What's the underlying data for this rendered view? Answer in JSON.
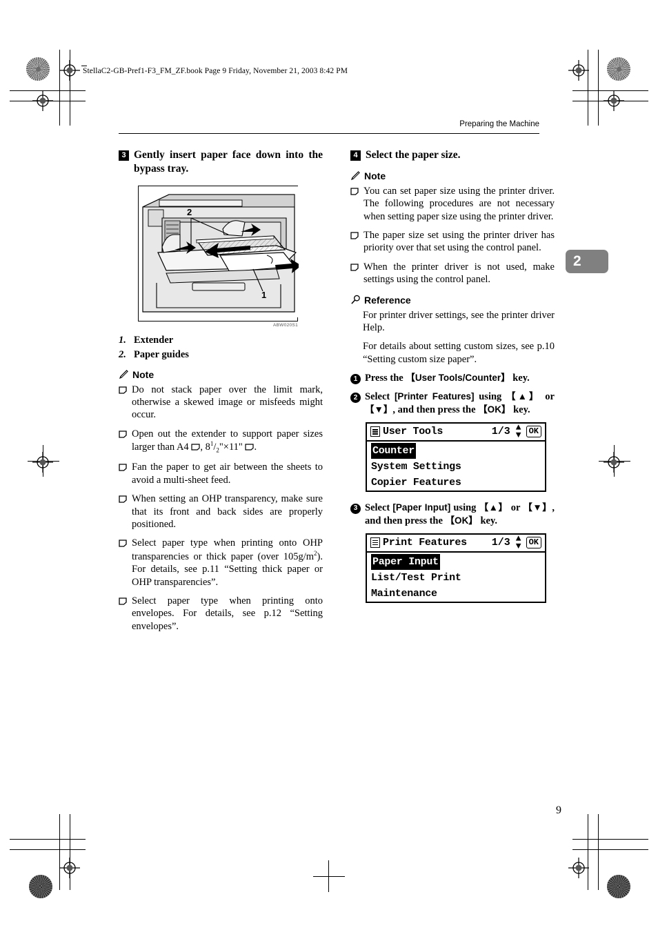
{
  "file_header": "StellaC2-GB-Pref1-F3_FM_ZF.book  Page 9  Friday, November 21, 2003  8:42 PM",
  "running_header": "Preparing the Machine",
  "chapter_tab": "2",
  "page_number": "9",
  "left_column": {
    "step": {
      "number": "3",
      "text": "Gently insert paper face down into the bypass tray."
    },
    "figure": {
      "code": "ABW020S1",
      "callout_1": "1",
      "callout_2": "2"
    },
    "callouts": [
      {
        "num": "1.",
        "label": "Extender"
      },
      {
        "num": "2.",
        "label": "Paper guides"
      }
    ],
    "note_heading": "Note",
    "notes": [
      "Do not stack paper over the limit mark, otherwise a skewed image or misfeeds might occur.",
      "Open out the extender to support paper sizes larger than A4",
      "Fan the paper to get air between the sheets to avoid a multi-sheet feed.",
      "When setting an OHP transparency, make sure that its front and back sides are properly positioned.",
      "Select paper type when printing onto OHP transparencies or thick paper (over 105g/m",
      "Select paper type when printing onto envelopes. For details, see p.12 “Setting envelopes”."
    ],
    "note2_tail": ", 8",
    "note2_frac_num": "1",
    "note2_frac_den": "2",
    "note2_tail2": "\"×11\" ",
    "note2_end": ".",
    "note5_sup": "2",
    "note5_tail": "). For details, see p.11 “Setting thick paper or OHP transparencies”."
  },
  "right_column": {
    "step": {
      "number": "4",
      "text": "Select the paper size."
    },
    "note_heading": "Note",
    "notes": [
      "You can set paper size using the printer driver. The following procedures are not necessary when setting paper size using the printer driver.",
      "The paper size set using the printer driver has priority over that set using the control panel.",
      "When the printer driver is not used, make settings using the control panel."
    ],
    "reference_heading": "Reference",
    "reference_paragraphs": [
      "For printer driver settings, see the printer driver Help.",
      "For details about setting custom sizes, see p.10 “Setting custom size paper”."
    ],
    "substeps": [
      {
        "num": "1",
        "parts": [
          "Press the ",
          "【User Tools/Counter】",
          " key."
        ]
      },
      {
        "num": "2",
        "parts": [
          "Select ",
          "[Printer Features]",
          " using ",
          "【▲】",
          " or ",
          "【▼】",
          ", and then press the ",
          "【OK】",
          " key."
        ]
      },
      {
        "num": "3",
        "parts": [
          "Select ",
          "[Paper Input]",
          " using ",
          "【▲】",
          " or ",
          "【▼】",
          ", and then press the ",
          "【OK】",
          " key."
        ]
      }
    ],
    "lcd_screens": [
      {
        "title": "User Tools",
        "page_indicator": "1/3",
        "ok_label": "OK",
        "rows": [
          {
            "label": "Counter",
            "selected": true
          },
          {
            "label": "System Settings",
            "selected": false
          },
          {
            "label": "Copier Features",
            "selected": false
          }
        ]
      },
      {
        "title": "Print Features",
        "page_indicator": "1/3",
        "ok_label": "OK",
        "rows": [
          {
            "label": "Paper Input",
            "selected": true
          },
          {
            "label": "List/Test Print",
            "selected": false
          },
          {
            "label": "Maintenance",
            "selected": false
          }
        ]
      }
    ]
  },
  "colors": {
    "chapter_tab_bg": "#808080",
    "text": "#000000",
    "page_bg": "#ffffff"
  }
}
